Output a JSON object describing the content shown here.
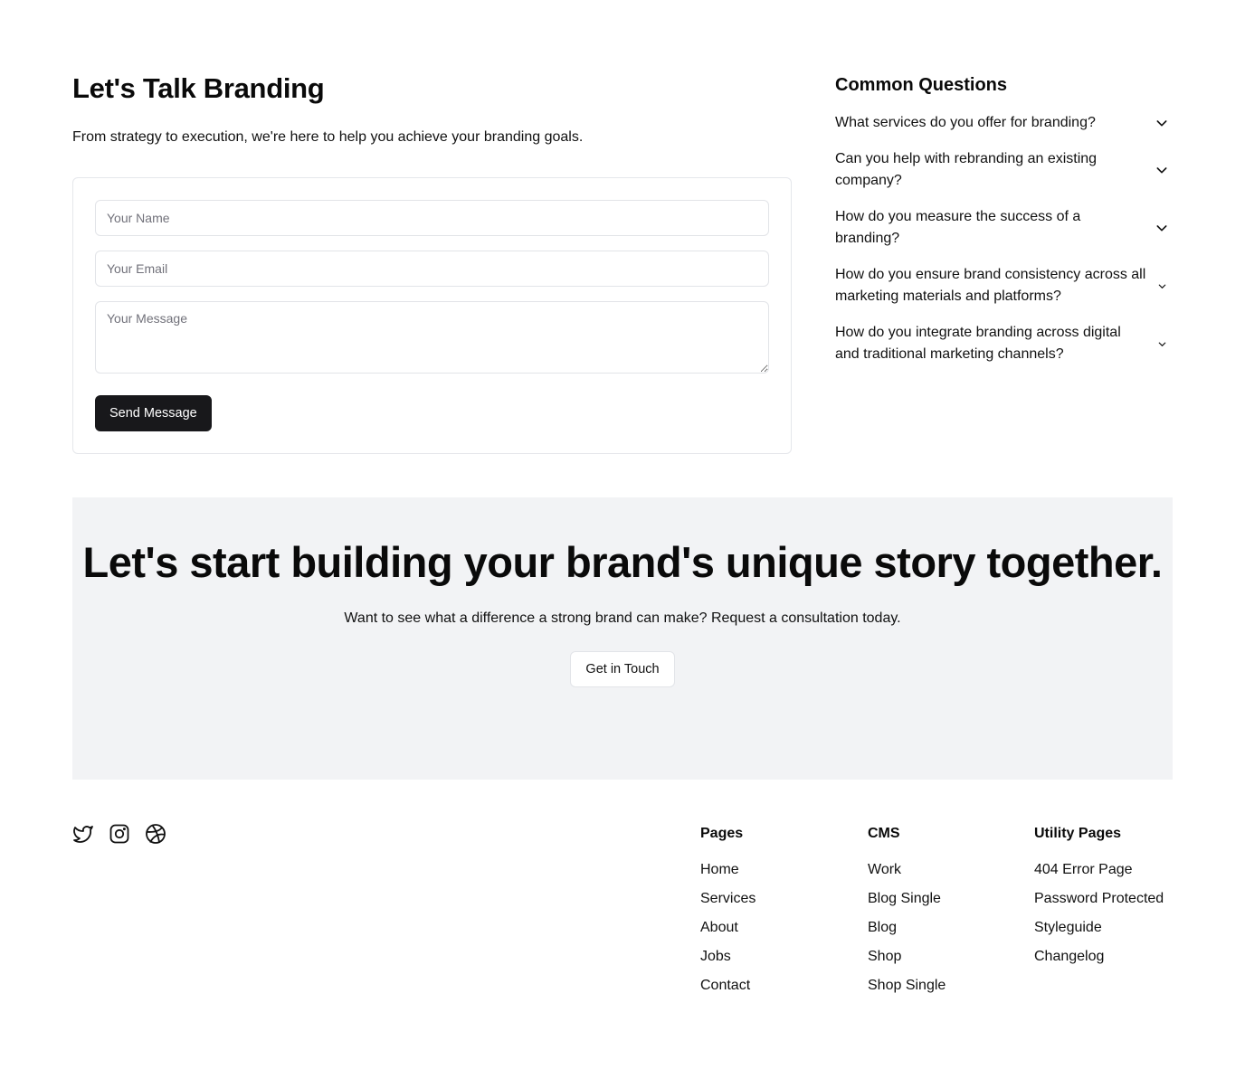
{
  "contact": {
    "title": "Let's Talk Branding",
    "lead": "From strategy to execution, we're here to help you achieve your branding goals.",
    "name_placeholder": "Your Name",
    "email_placeholder": "Your Email",
    "message_placeholder": "Your Message",
    "send_label": "Send Message"
  },
  "faq": {
    "title": "Common Questions",
    "items": [
      {
        "question": "What services do you offer for branding?",
        "icon": "chevron-down-icon"
      },
      {
        "question": "Can you help with rebranding an existing company?",
        "icon": "chevron-down-icon"
      },
      {
        "question": "How do you measure the success of a branding?",
        "icon": "chevron-down-icon"
      },
      {
        "question": "How do you ensure brand consistency across all marketing materials and platforms?",
        "icon": "chevron-down-icon"
      },
      {
        "question": "How do you integrate branding across digital and traditional marketing channels?",
        "icon": "chevron-down-icon"
      }
    ]
  },
  "cta": {
    "headline": "Let's start building your brand's unique story together.",
    "subtext": "Want to see what a difference a strong brand can make? Request a consultation today.",
    "button_label": "Get in Touch"
  },
  "footer": {
    "social": [
      "twitter-icon",
      "instagram-icon",
      "dribbble-icon"
    ],
    "columns": [
      {
        "title": "Pages",
        "links": [
          "Home",
          "Services",
          "About",
          "Jobs",
          "Contact"
        ]
      },
      {
        "title": "CMS",
        "links": [
          "Work",
          "Blog Single",
          "Blog",
          "Shop",
          "Shop Single"
        ]
      },
      {
        "title": "Utility Pages",
        "links": [
          "404 Error Page",
          "Password Protected",
          "Styleguide",
          "Changelog"
        ]
      }
    ]
  }
}
